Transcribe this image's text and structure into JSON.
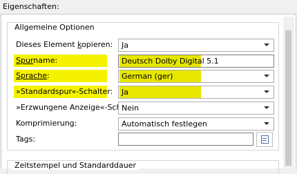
{
  "properties_heading": "Eigenschaften:",
  "general_group": {
    "title": "Allgemeine Optionen",
    "rows": [
      {
        "label_pre": "Dieses Element ",
        "label_ul": "k",
        "label_post": "opieren:",
        "value": "Ja"
      },
      {
        "label_pre": "",
        "label_ul": "Spur",
        "label_post": "name:",
        "value": "Deutsch Dolby Digital 5.1"
      },
      {
        "label_pre": "",
        "label_ul": "Sprache",
        "label_post": ":",
        "value": "German (ger)"
      },
      {
        "label_pre": "»Standardspur«-Schalter:",
        "label_ul": "",
        "label_post": "",
        "value": "Ja"
      },
      {
        "label_pre": "»Erzwungene Anzeige«-Schalter:",
        "label_ul": "",
        "label_post": "",
        "value": "Nein"
      },
      {
        "label_pre": "Komprimierung:",
        "label_ul": "",
        "label_post": "",
        "value": "Automatisch festlegen"
      },
      {
        "label_pre": "Tags:",
        "label_ul": "",
        "label_post": "",
        "value": ""
      }
    ]
  },
  "timestamps_group": {
    "title": "Zeitstempel und Standarddauer"
  },
  "highlight_color": "#f5f200"
}
